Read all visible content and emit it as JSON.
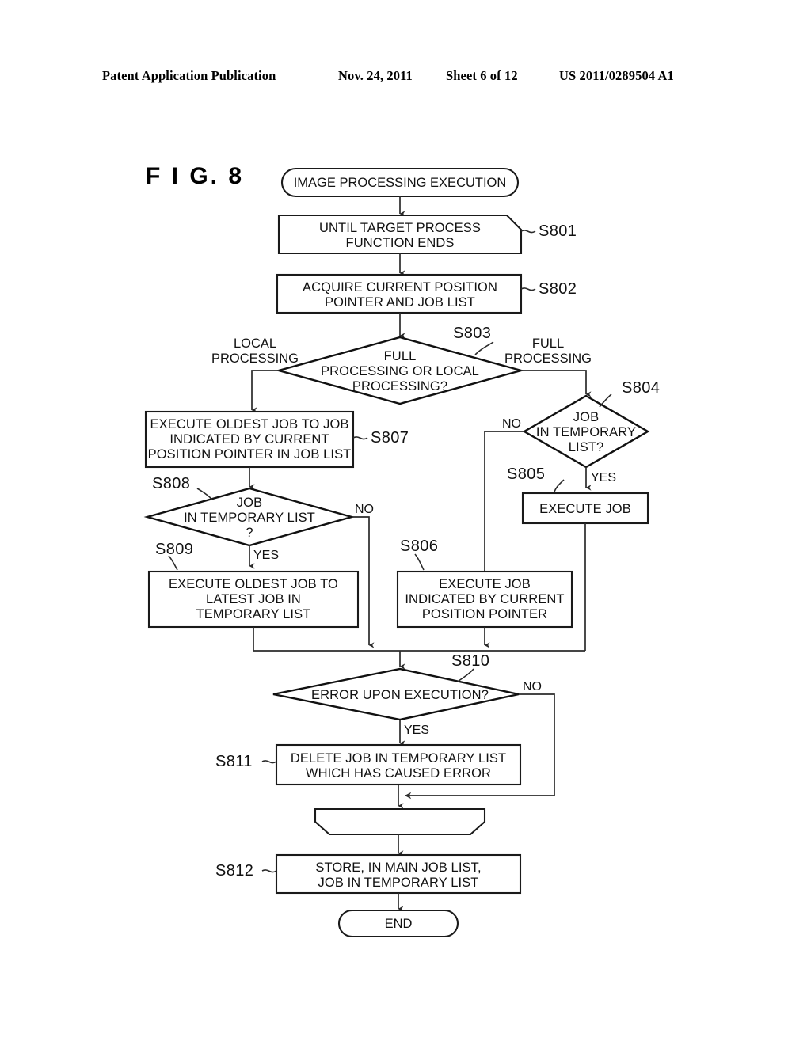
{
  "header": {
    "publication": "Patent Application Publication",
    "date": "Nov. 24, 2011",
    "sheet": "Sheet 6 of 12",
    "number": "US 2011/0289504 A1"
  },
  "figure": {
    "label": "F I G.  8"
  },
  "flowchart": {
    "start_terminal": "IMAGE PROCESSING EXECUTION",
    "end_terminal": "END",
    "nodes": [
      {
        "id": "S801",
        "shape": "loop-start",
        "lines": [
          "UNTIL TARGET PROCESS",
          "FUNCTION ENDS"
        ]
      },
      {
        "id": "S802",
        "shape": "process",
        "lines": [
          "ACQUIRE CURRENT POSITION",
          "POINTER AND JOB LIST"
        ]
      },
      {
        "id": "S803",
        "shape": "decision",
        "lines": [
          "FULL",
          "PROCESSING OR LOCAL",
          "PROCESSING?"
        ]
      },
      {
        "id": "S804",
        "shape": "decision",
        "lines": [
          "JOB",
          "IN TEMPORARY",
          "LIST?"
        ]
      },
      {
        "id": "S805",
        "shape": "process",
        "lines": [
          "EXECUTE JOB"
        ]
      },
      {
        "id": "S806",
        "shape": "process",
        "lines": [
          "EXECUTE JOB",
          "INDICATED BY CURRENT",
          "POSITION POINTER"
        ]
      },
      {
        "id": "S807",
        "shape": "process",
        "lines": [
          "EXECUTE OLDEST JOB TO JOB",
          "INDICATED BY CURRENT",
          "POSITION POINTER IN JOB LIST"
        ]
      },
      {
        "id": "S808",
        "shape": "decision",
        "lines": [
          "JOB",
          "IN TEMPORARY LIST",
          "?"
        ]
      },
      {
        "id": "S809",
        "shape": "process",
        "lines": [
          "EXECUTE OLDEST JOB TO",
          "LATEST JOB IN",
          "TEMPORARY LIST"
        ]
      },
      {
        "id": "S810",
        "shape": "decision",
        "lines": [
          "ERROR UPON EXECUTION?"
        ]
      },
      {
        "id": "S811",
        "shape": "process",
        "lines": [
          "DELETE JOB IN TEMPORARY LIST",
          "WHICH HAS CAUSED ERROR"
        ]
      },
      {
        "id": "loop-end",
        "shape": "loop-end",
        "lines": []
      },
      {
        "id": "S812",
        "shape": "process",
        "lines": [
          "STORE, IN MAIN JOB LIST,",
          "JOB IN TEMPORARY LIST"
        ]
      }
    ],
    "branch_labels": {
      "s803_left_line1": "LOCAL",
      "s803_left_line2": "PROCESSING",
      "s803_right_line1": "FULL",
      "s803_right_line2": "PROCESSING",
      "s804_no": "NO",
      "s804_yes": "YES",
      "s808_no": "NO",
      "s808_yes": "YES",
      "s810_no": "NO",
      "s810_yes": "YES"
    }
  }
}
